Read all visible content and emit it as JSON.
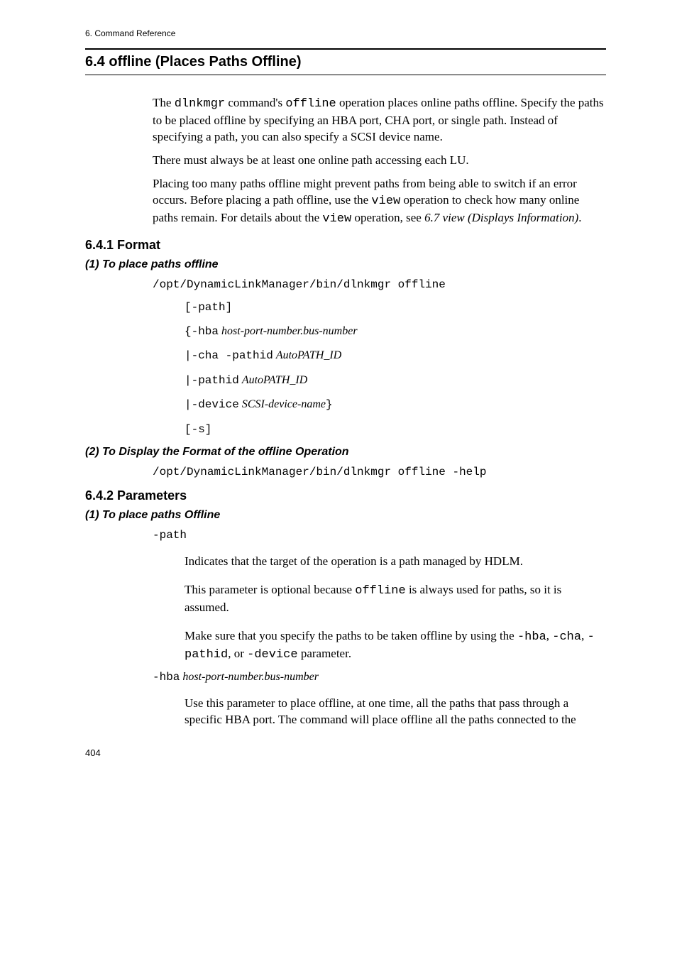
{
  "header": {
    "chapter": "6. Command Reference"
  },
  "section": {
    "title": "6.4  offline (Places Paths Offline)"
  },
  "intro": {
    "p1a": "The ",
    "p1b": "dlnkmgr",
    "p1c": " command's ",
    "p1d": "offline",
    "p1e": " operation places online paths offline. Specify the paths to be placed offline by specifying an HBA port, CHA port, or single path. Instead of specifying a path, you can also specify a SCSI device name.",
    "p2": "There must always be at least one online path accessing each LU.",
    "p3a": "Placing too many paths offline might prevent paths from being able to switch if an error occurs. Before placing a path offline, use the ",
    "p3b": "view",
    "p3c": " operation to check how many online paths remain. For details about the ",
    "p3d": "view",
    "p3e": " operation, see ",
    "p3f": "6.7  view (Displays Information)",
    "p3g": "."
  },
  "format": {
    "title": "6.4.1  Format",
    "sub1": "(1)  To place paths offline",
    "cmd1": "/opt/DynamicLinkManager/bin/dlnkmgr offline",
    "l1": "[-path]",
    "l2a": "{-hba",
    "l2b": "host-port-number.bus-number",
    "l3a": "|-cha -pathid",
    "l3b": "AutoPATH_ID",
    "l4a": "|-pathid",
    "l4b": "AutoPATH_ID",
    "l5a": "|-device",
    "l5b": "SCSI-device-name",
    "l5c": "}",
    "l6": "[-s]",
    "sub2": "(2)  To Display the Format of the offline Operation",
    "cmd2": "/opt/DynamicLinkManager/bin/dlnkmgr offline -help"
  },
  "params": {
    "title": "6.4.2  Parameters",
    "sub1": "(1)  To place paths Offline",
    "t1": "-path",
    "d1": "Indicates that the target of the operation is a path managed by HDLM.",
    "d2a": "This parameter is optional because ",
    "d2b": "offline",
    "d2c": " is always used for paths, so it is assumed.",
    "d3a": "Make sure that you specify the paths to be taken offline by using the ",
    "d3b": "-hba",
    "d3c": ", ",
    "d3d": "-cha",
    "d3e": ", ",
    "d3f": "-pathid",
    "d3g": ", or ",
    "d3h": "-device",
    "d3i": " parameter.",
    "t2a": "-hba",
    "t2b": "host-port-number.bus-number",
    "d4": "Use this parameter to place offline, at one time, all the paths that pass through a specific HBA port. The command will place offline all the paths connected to the"
  },
  "footer": {
    "pagenum": "404"
  }
}
